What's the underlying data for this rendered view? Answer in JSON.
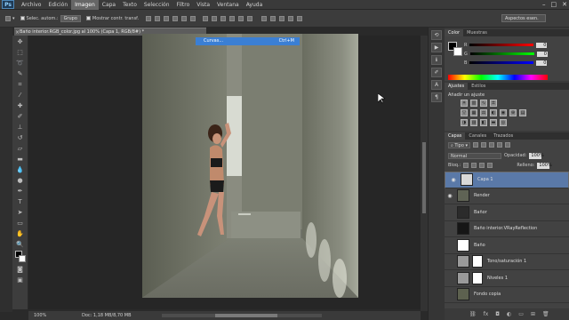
{
  "app": {
    "logo": "Ps"
  },
  "menu": [
    "Archivo",
    "Edición",
    "Imagen",
    "Capa",
    "Texto",
    "Selección",
    "Filtro",
    "Vista",
    "Ventana",
    "Ayuda"
  ],
  "menu_active_index": 2,
  "window_controls": [
    "–",
    "□",
    "✕"
  ],
  "options_bar": {
    "auto_select_label": "Selec. autom.:",
    "auto_select_value": "Grupo",
    "show_transform_label": "Mostrar contr. transf."
  },
  "workspace": "Aspectos esen.",
  "document": {
    "tab_title": "Baño interior.RGB_color.jpg al 100% (Capa 1, RGB/8#) *",
    "close_glyph": "×"
  },
  "context_menu": {
    "label": "Curvas...",
    "shortcut": "Ctrl+M"
  },
  "status": {
    "zoom": "100%",
    "doc_info": "Doc: 1,18 MB/8,70 MB"
  },
  "color_panel": {
    "tabs": [
      "Color",
      "Muestras"
    ],
    "channels": [
      {
        "name": "R",
        "value": "0",
        "color": "#ff4a4a"
      },
      {
        "name": "G",
        "value": "0",
        "color": "#4ad04a"
      },
      {
        "name": "B",
        "value": "0",
        "color": "#4a6aff"
      }
    ]
  },
  "adjustments_panel": {
    "tabs": [
      "Ajustes",
      "Estilos"
    ],
    "title": "Añadir un ajuste",
    "icons_row1": [
      "brightness-icon",
      "levels-icon",
      "curves-icon",
      "exposure-icon"
    ],
    "icons_row2": [
      "vibrance-icon",
      "hue-icon",
      "color-balance-icon",
      "bw-icon",
      "photo-filter-icon",
      "channel-mixer-icon",
      "lookup-icon"
    ],
    "icons_row3": [
      "invert-icon",
      "posterize-icon",
      "threshold-icon",
      "gradient-map-icon",
      "selective-color-icon"
    ]
  },
  "layers_panel": {
    "tabs": [
      "Capas",
      "Canales",
      "Trazados"
    ],
    "filter_label": "Tipo",
    "blend_mode": "Normal",
    "opacity_label": "Opacidad:",
    "opacity_value": "100%",
    "lock_label": "Bloq.:",
    "fill_label": "Relleno:",
    "fill_value": "100%",
    "layers": [
      {
        "name": "Capa 1",
        "visible": true,
        "selected": true,
        "thumb": "#d9d9d9",
        "mask": false
      },
      {
        "name": "Render",
        "visible": true,
        "selected": false,
        "thumb": "#5f6355",
        "mask": false
      },
      {
        "name": "Bañor",
        "visible": false,
        "selected": false,
        "thumb": "#2b2b2b",
        "mask": false
      },
      {
        "name": "Baño interior.VRayReflection",
        "visible": false,
        "selected": false,
        "thumb": "#161616",
        "mask": false
      },
      {
        "name": "Baño",
        "visible": false,
        "selected": false,
        "thumb": "#ffffff",
        "mask": false
      },
      {
        "name": "Tono/saturación 1",
        "visible": false,
        "selected": false,
        "thumb": "#9a9a9a",
        "mask": true
      },
      {
        "name": "Niveles 1",
        "visible": false,
        "selected": false,
        "thumb": "#9a9a9a",
        "mask": true
      },
      {
        "name": "Fondo copia",
        "visible": false,
        "selected": false,
        "thumb": "#5d614f",
        "mask": false
      }
    ],
    "footer_icons": [
      "link-icon",
      "fx-icon",
      "mask-icon",
      "adjustment-icon",
      "folder-icon",
      "new-layer-icon",
      "trash-icon"
    ]
  }
}
